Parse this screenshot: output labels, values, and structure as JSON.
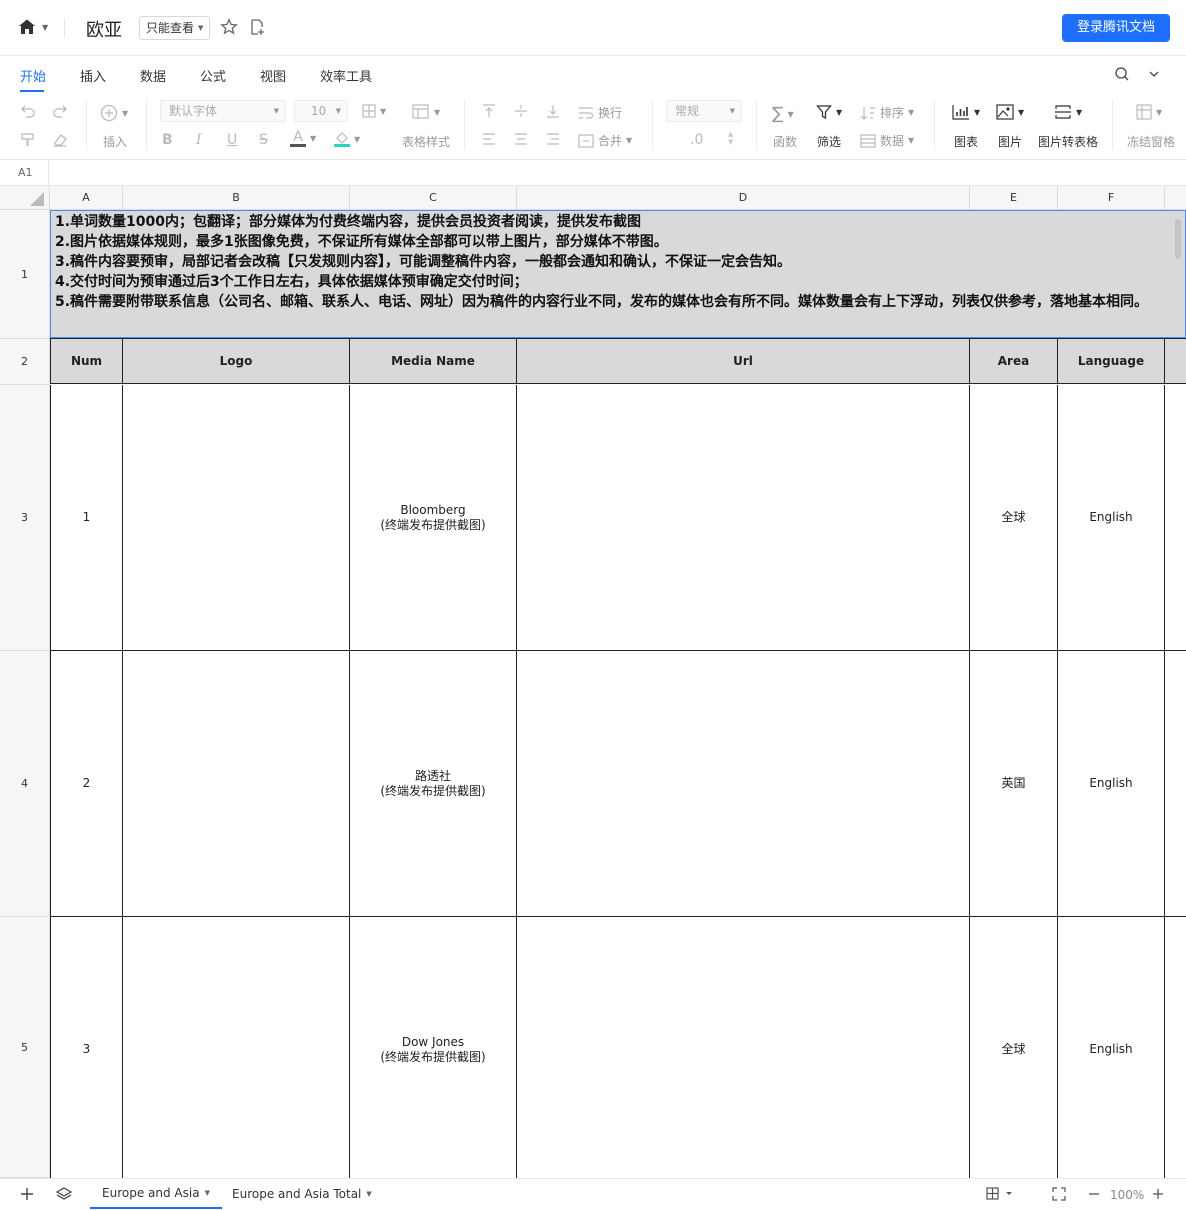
{
  "app": {
    "doc_title": "欧亚",
    "view_mode": "只能查看",
    "login_button": "登录腾讯文档"
  },
  "menu_tabs": [
    "开始",
    "插入",
    "数据",
    "公式",
    "视图",
    "效率工具"
  ],
  "toolbar": {
    "insert": "插入",
    "font_name": "默认字体",
    "font_size": "10",
    "table_style": "表格样式",
    "wrap": "换行",
    "merge": "合并",
    "number_format": "常规",
    "decimal": ".0",
    "function": "函数",
    "filter": "筛选",
    "sort": "排序",
    "data": "数据",
    "chart": "图表",
    "image": "图片",
    "image_to_table": "图片转表格",
    "freeze": "冻结窗格"
  },
  "formula_bar": {
    "cell_ref": "A1"
  },
  "columns": [
    "A",
    "B",
    "C",
    "D",
    "E",
    "F"
  ],
  "row_numbers": [
    "1",
    "2",
    "3",
    "4",
    "5"
  ],
  "notes": [
    "1.单词数量1000内；包翻译；部分媒体为付费终端内容，提供会员投资者阅读，提供发布截图",
    "2.图片依据媒体规则，最多1张图像免费，不保证所有媒体全部都可以带上图片，部分媒体不带图。",
    "3.稿件内容要预审，局部记者会改稿【只发规则内容】，可能调整稿件内容，一般都会通知和确认，不保证一定会告知。",
    "4.交付时间为预审通过后3个工作日左右，具体依据媒体预审确定交付时间；",
    "5.稿件需要附带联系信息（公司名、邮箱、联系人、电话、网址）因为稿件的内容行业不同，发布的媒体也会有所不同。媒体数量会有上下浮动，列表仅供参考，落地基本相同。"
  ],
  "table": {
    "headers": [
      "Num",
      "Logo",
      "Media Name",
      "Url",
      "Area",
      "Language"
    ],
    "rows": [
      {
        "num": "1",
        "logo": "",
        "media_name": "Bloomberg",
        "media_note": "(终端发布提供截图)",
        "url": "",
        "area": "全球",
        "language": "English"
      },
      {
        "num": "2",
        "logo": "",
        "media_name": "路透社",
        "media_note": "(终端发布提供截图)",
        "url": "",
        "area": "英国",
        "language": "English"
      },
      {
        "num": "3",
        "logo": "",
        "media_name": "Dow Jones",
        "media_note": "(终端发布提供截图)",
        "url": "",
        "area": "全球",
        "language": "English"
      }
    ]
  },
  "sheets": [
    "Europe and Asia",
    "Europe and Asia Total"
  ],
  "zoom": "100%"
}
